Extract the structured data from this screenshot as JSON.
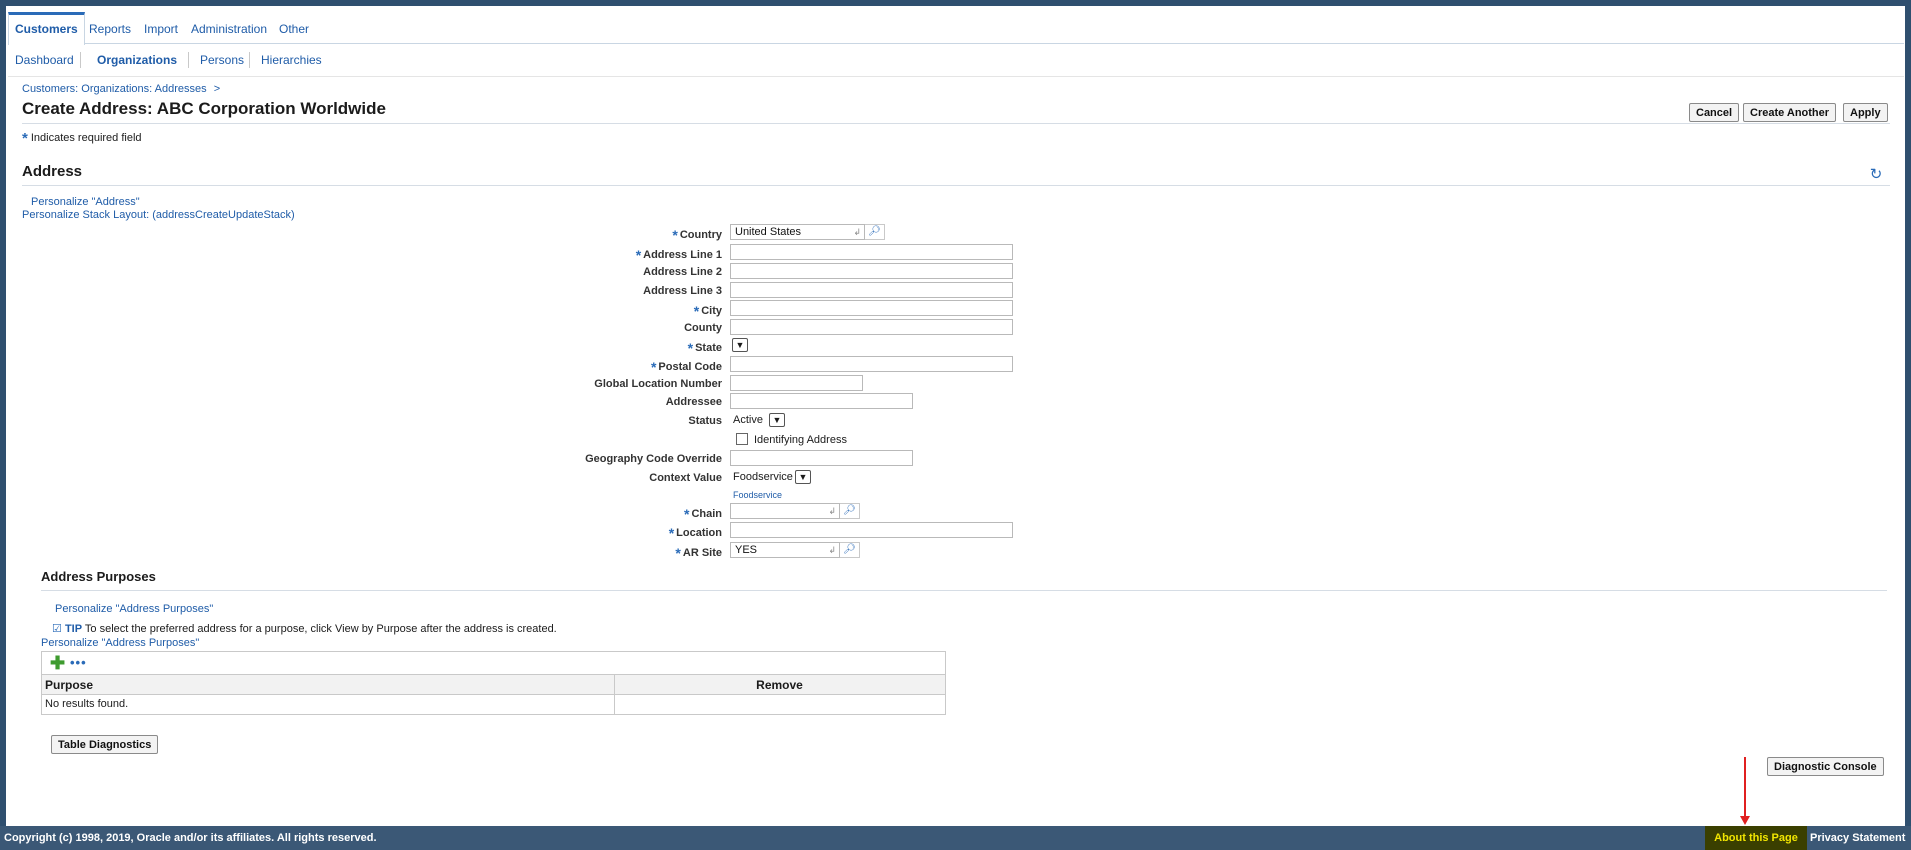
{
  "tabs": [
    "Customers",
    "Reports",
    "Import",
    "Administration",
    "Other"
  ],
  "subtabs": [
    "Dashboard",
    "Organizations",
    "Persons",
    "Hierarchies"
  ],
  "breadcrumb": "Customers: Organizations: Addresses",
  "breadcrumb_sep": ">",
  "title": "Create Address: ABC Corporation Worldwide",
  "buttons": {
    "cancel": "Cancel",
    "create_another": "Create Another",
    "apply": "Apply"
  },
  "required_star": "*",
  "required_note": "Indicates required field",
  "address_section": {
    "heading": "Address",
    "personalize_link": "Personalize \"Address\"",
    "stack_link": "Personalize Stack Layout: (addressCreateUpdateStack)"
  },
  "fields": {
    "country": {
      "label": "Country",
      "value": "United States"
    },
    "address1": {
      "label": "Address Line 1",
      "value": ""
    },
    "address2": {
      "label": "Address Line 2",
      "value": ""
    },
    "address3": {
      "label": "Address Line 3",
      "value": ""
    },
    "city": {
      "label": "City",
      "value": ""
    },
    "county": {
      "label": "County",
      "value": ""
    },
    "state": {
      "label": "State",
      "value": ""
    },
    "postal": {
      "label": "Postal Code",
      "value": ""
    },
    "gln": {
      "label": "Global Location Number",
      "value": ""
    },
    "addressee": {
      "label": "Addressee",
      "value": ""
    },
    "status": {
      "label": "Status",
      "value": "Active"
    },
    "identifying": {
      "label": "Identifying Address"
    },
    "geo_override": {
      "label": "Geography Code Override",
      "value": ""
    },
    "context": {
      "label": "Context Value",
      "value": "Foodservice",
      "sublink": "Foodservice"
    },
    "chain": {
      "label": "Chain",
      "value": ""
    },
    "location": {
      "label": "Location",
      "value": ""
    },
    "ar_site": {
      "label": "AR Site",
      "value": "YES"
    }
  },
  "purposes_section": {
    "heading": "Address Purposes",
    "personalize_link": "Personalize \"Address Purposes\"",
    "tip_label": "TIP",
    "tip_text": "To select the preferred address for a purpose, click View by Purpose after the address is created.",
    "personalize_link2": "Personalize \"Address Purposes\"",
    "more_icon": "•••",
    "col_purpose": "Purpose",
    "col_remove": "Remove",
    "empty_text": "No results found."
  },
  "table_diagnostics": "Table Diagnostics",
  "diagnostic_console": "Diagnostic Console",
  "footer": {
    "copyright": "Copyright (c) 1998, 2019, Oracle and/or its affiliates. All rights reserved.",
    "about": "About this Page",
    "privacy": "Privacy Statement"
  },
  "colors": {
    "brand": "#2f4f6f",
    "link": "#1f5ca8",
    "annotation_arrow": "#e02020"
  }
}
